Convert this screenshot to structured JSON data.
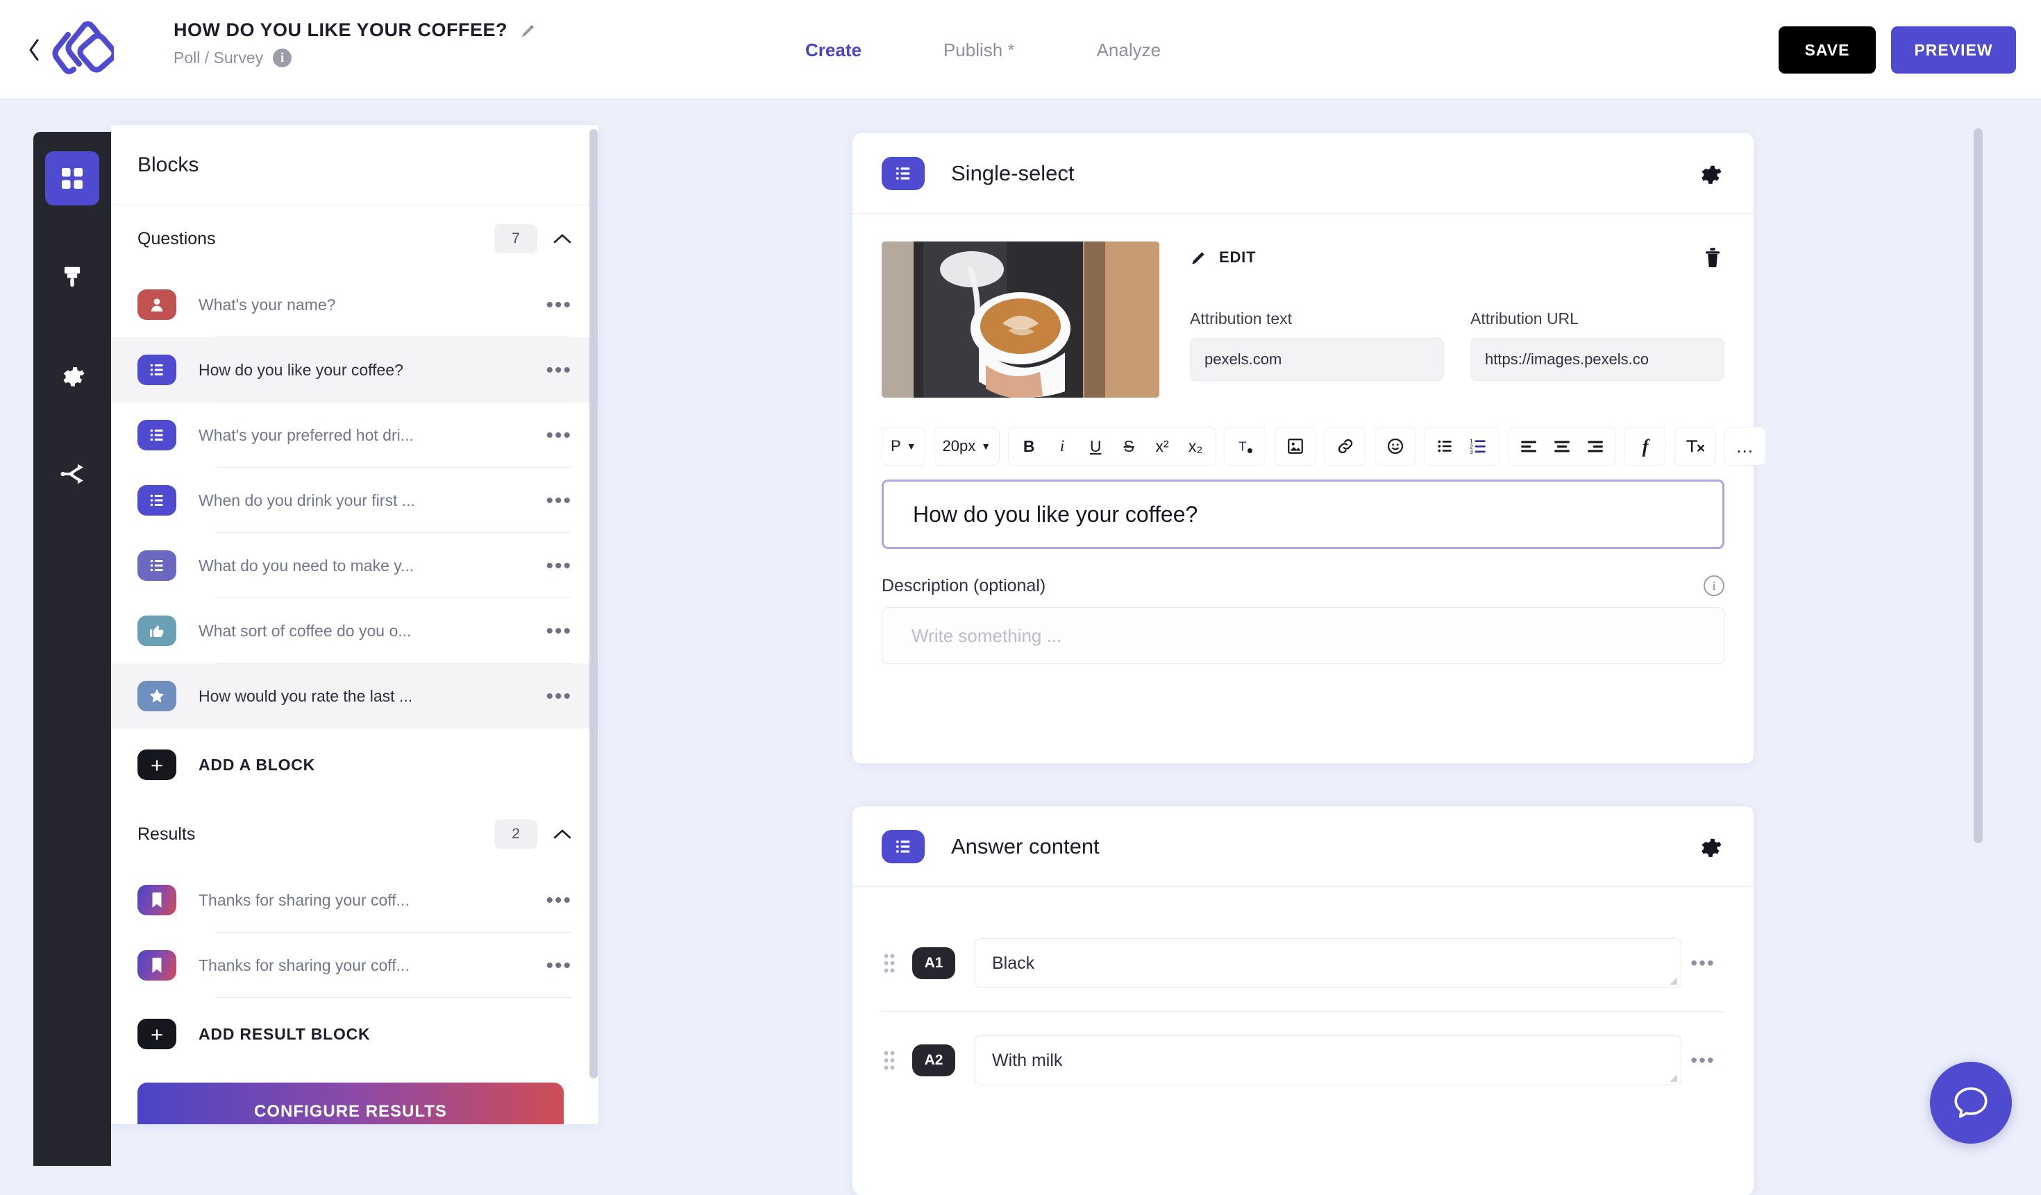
{
  "header": {
    "back_icon": "chevron-left-icon",
    "logo_icon": "brand-logo-icon",
    "title": "HOW DO YOU LIKE YOUR COFFEE?",
    "title_edit_icon": "pencil-icon",
    "subtitle": "Poll / Survey",
    "info_icon_char": "i",
    "nav": [
      {
        "label": "Create",
        "active": true
      },
      {
        "label": "Publish *",
        "active": false
      },
      {
        "label": "Analyze",
        "active": false
      }
    ],
    "save_label": "SAVE",
    "preview_label": "PREVIEW"
  },
  "rail": {
    "items": [
      {
        "name": "blocks-icon",
        "active": true
      },
      {
        "name": "design-brush-icon",
        "active": false
      },
      {
        "name": "settings-gear-icon",
        "active": false
      },
      {
        "name": "share-logic-icon",
        "active": false
      }
    ]
  },
  "panel": {
    "title": "Blocks",
    "sections": [
      {
        "name": "Questions",
        "count": "7",
        "collapse_icon": "chevron-up-icon",
        "items": [
          {
            "label": "What's your name?",
            "icon": "person-icon",
            "color": "#c25252",
            "selected": false
          },
          {
            "label": "How do you like your coffee?",
            "icon": "list-icon",
            "color": "#4f4bd0",
            "selected": true
          },
          {
            "label": "What's your preferred hot dri...",
            "icon": "list-icon",
            "color": "#4f4bd0",
            "selected": false
          },
          {
            "label": "When do you drink your first ...",
            "icon": "list-icon",
            "color": "#4f4bd0",
            "selected": false
          },
          {
            "label": "What do you need to make y...",
            "icon": "list-icon",
            "color": "#6b68c2",
            "selected": false
          },
          {
            "label": "What sort of coffee do you o...",
            "icon": "thumbs-up-icon",
            "color": "#69a0b5",
            "selected": false
          },
          {
            "label": "How would you rate the last ...",
            "icon": "star-icon",
            "color": "#6e8fc0",
            "selected": true
          }
        ],
        "add_label": "ADD A BLOCK"
      },
      {
        "name": "Results",
        "count": "2",
        "collapse_icon": "chevron-up-icon",
        "items": [
          {
            "label": "Thanks for sharing your coff...",
            "icon": "bookmark-icon",
            "color": "gradient",
            "selected": false
          },
          {
            "label": "Thanks for sharing your coff...",
            "icon": "bookmark-icon",
            "color": "gradient",
            "selected": false
          }
        ],
        "add_label": "ADD RESULT BLOCK"
      }
    ],
    "configure_label": "CONFIGURE RESULTS"
  },
  "question_card": {
    "type_icon": "list-icon",
    "title": "Single-select",
    "gear_icon": "gear-icon",
    "media": {
      "alt": "coffee-latte-photo",
      "edit_icon": "pencil-icon",
      "edit_label": "EDIT",
      "delete_icon": "trash-icon",
      "attribution_text_label": "Attribution text",
      "attribution_text_value": "pexels.com",
      "attribution_url_label": "Attribution URL",
      "attribution_url_value": "https://images.pexels.co"
    },
    "toolbar": {
      "block_format": "P",
      "font_size": "20px",
      "buttons": [
        {
          "name": "bold-icon",
          "glyph": "B"
        },
        {
          "name": "italic-icon",
          "glyph": "i"
        },
        {
          "name": "underline-icon",
          "glyph": "U"
        },
        {
          "name": "strikethrough-icon",
          "glyph": "S"
        },
        {
          "name": "superscript-icon",
          "glyph": "x²"
        },
        {
          "name": "subscript-icon",
          "glyph": "x₂"
        },
        {
          "name": "text-color-icon",
          "glyph": "T"
        },
        {
          "name": "insert-image-icon",
          "glyph": "▣"
        },
        {
          "name": "insert-link-icon",
          "glyph": "🔗"
        },
        {
          "name": "emoji-icon",
          "glyph": "☺"
        },
        {
          "name": "bulleted-list-icon",
          "glyph": "•"
        },
        {
          "name": "numbered-list-icon",
          "glyph": "1."
        },
        {
          "name": "align-left-icon",
          "glyph": "≡"
        },
        {
          "name": "align-center-icon",
          "glyph": "≡"
        },
        {
          "name": "align-right-icon",
          "glyph": "≡"
        },
        {
          "name": "formula-icon",
          "glyph": "f"
        },
        {
          "name": "clear-format-icon",
          "glyph": "Tx"
        },
        {
          "name": "more-options-icon",
          "glyph": "…"
        }
      ]
    },
    "question_text": "How do you like your coffee?",
    "description_label": "Description (optional)",
    "description_info_icon": "info-icon",
    "description_placeholder": "Write something ..."
  },
  "answer_card": {
    "type_icon": "list-icon",
    "title": "Answer content",
    "gear_icon": "gear-icon",
    "rows": [
      {
        "badge": "A1",
        "value": "Black",
        "grip_icon": "drag-handle-icon",
        "menu_icon": "more-dots-icon"
      },
      {
        "badge": "A2",
        "value": "With milk",
        "grip_icon": "drag-handle-icon",
        "menu_icon": "more-dots-icon"
      }
    ]
  },
  "chat": {
    "icon": "chat-bubble-icon"
  },
  "colors": {
    "accent": "#4f4bd0",
    "dark": "#25262e",
    "page_bg": "#edf0fb",
    "muted_text": "#8b8f9e"
  }
}
